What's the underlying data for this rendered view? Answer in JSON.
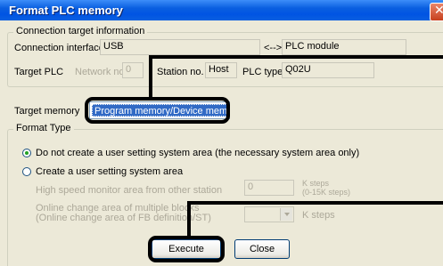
{
  "window": {
    "title": "Format PLC memory",
    "close_glyph": "✕"
  },
  "connection": {
    "group_title": "Connection target information",
    "interface_label": "Connection interface",
    "interface_value": "USB",
    "arrow_text": "<-->",
    "module_value": "PLC module",
    "target_plc_label": "Target PLC",
    "network_label": "Network no.",
    "network_value": "0",
    "station_label": "Station no.",
    "station_value": "Host",
    "plc_type_label": "PLC type",
    "plc_type_value": "Q02U"
  },
  "target_memory": {
    "label": "Target memory",
    "value": "Program memory/Device memory"
  },
  "format_type": {
    "group_title": "Format Type",
    "option1": "Do not create a user setting system area (the necessary system area only)",
    "option2": "Create a user setting system area",
    "selected": "option1",
    "hs_monitor_label": "High speed monitor area from other station",
    "hs_monitor_value": "0",
    "hs_monitor_unit": "K steps",
    "hs_monitor_hint": "(0-15K steps)",
    "online_change_label1": "Online change area of multiple blocks",
    "online_change_label2": "(Online change area of FB definition/ST)",
    "online_change_unit": "K steps"
  },
  "buttons": {
    "execute": "Execute",
    "close": "Close"
  },
  "colors": {
    "title_bar": "#0054e3",
    "selection": "#316ac5",
    "callout": "#000000"
  }
}
